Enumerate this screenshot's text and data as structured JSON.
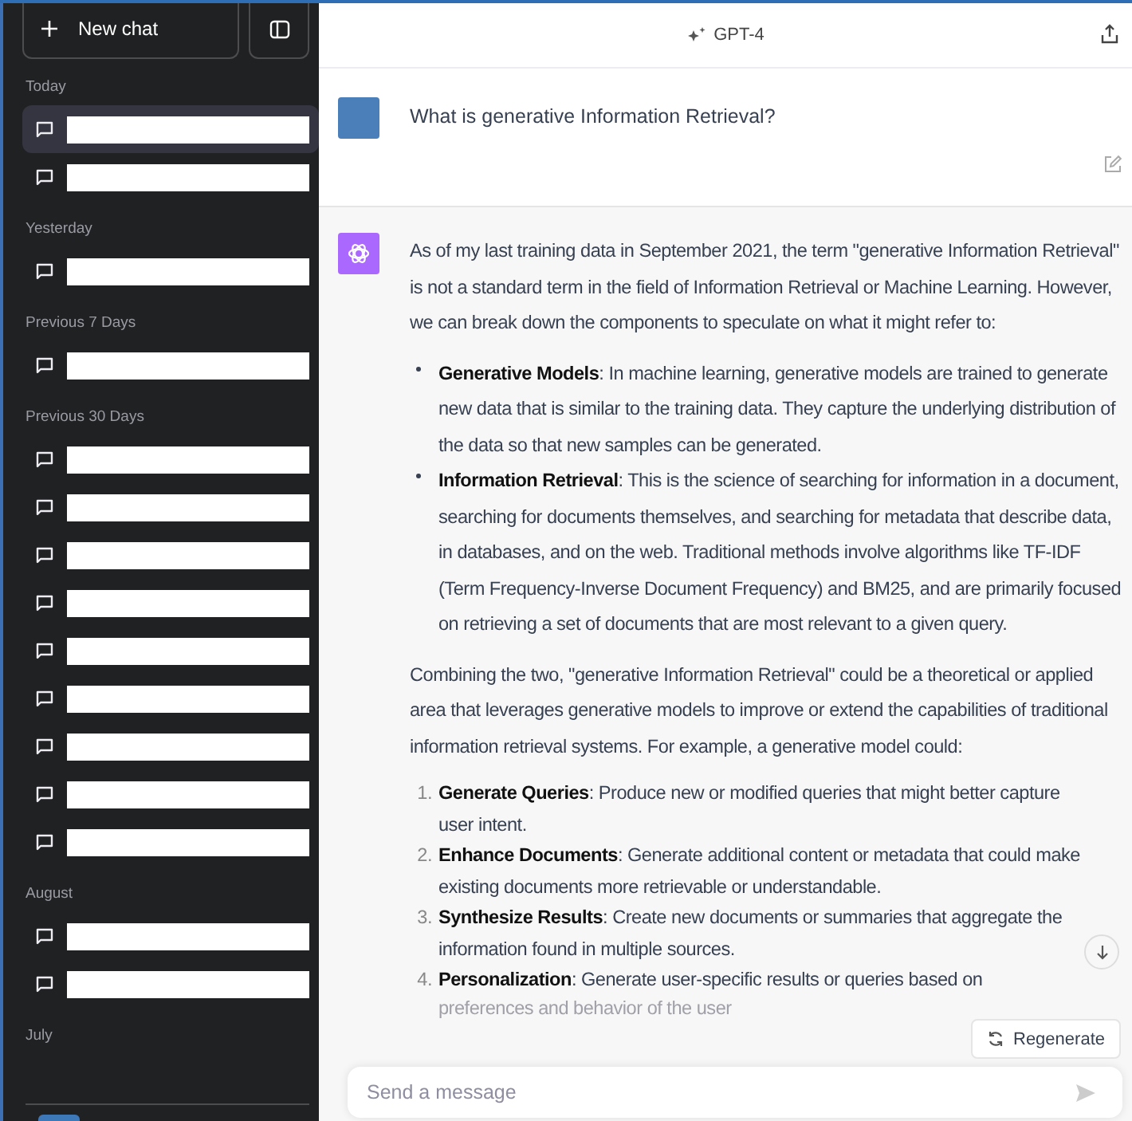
{
  "sidebar": {
    "new_chat_label": "New chat",
    "sections": [
      {
        "label": "Today",
        "chats": [
          {
            "selected": true
          },
          {
            "selected": false
          }
        ]
      },
      {
        "label": "Yesterday",
        "chats": [
          {
            "selected": false
          }
        ]
      },
      {
        "label": "Previous 7 Days",
        "chats": [
          {
            "selected": false
          }
        ]
      },
      {
        "label": "Previous 30 Days",
        "chats": [
          {
            "selected": false
          },
          {
            "selected": false
          },
          {
            "selected": false
          },
          {
            "selected": false
          },
          {
            "selected": false
          },
          {
            "selected": false
          },
          {
            "selected": false
          },
          {
            "selected": false
          },
          {
            "selected": false
          }
        ]
      },
      {
        "label": "August",
        "chats": [
          {
            "selected": false
          },
          {
            "selected": false
          }
        ]
      },
      {
        "label": "July"
      }
    ]
  },
  "header": {
    "model": "GPT-4"
  },
  "user_message": {
    "text": "What is generative Information Retrieval?"
  },
  "assistant_message": {
    "intro": "As of my last training data in September 2021, the term \"generative Information Retrieval\" is not a standard term in the field of Information Retrieval or Machine Learning. However, we can break down the components to speculate on what it might refer to:",
    "bullets": [
      {
        "text": "**Generative Models**: In machine learning, generative models are trained to generate new data that is similar to the training data. They capture the underlying distribution of the data so that new samples can be generated."
      },
      {
        "text": "**Information Retrieval**: This is the science of searching for information in a document, searching for documents themselves, and searching for metadata that describe data, in databases, and on the web. Traditional methods involve algorithms like TF-IDF (Term Frequency-Inverse Document Frequency) and BM25, and are primarily focused on retrieving a set of documents that are most relevant to a given query."
      }
    ],
    "middle": "Combining the two, \"generative Information Retrieval\" could be a theoretical or applied area that leverages generative models to improve or extend the capabilities of traditional information retrieval systems. For example, a generative model could:",
    "steps": [
      {
        "number": "1.",
        "lines": [
          "**Generate Queries**: Produce new or modified queries that might better capture user intent."
        ]
      },
      {
        "number": "2.",
        "lines": [
          "**Enhance Documents**: Generate additional content or metadata that could make existing documents more retrievable or understandable."
        ]
      },
      {
        "number": "3.",
        "lines": [
          "**Synthesize Results**: Create new documents or summaries that aggregate the information found in multiple sources."
        ]
      },
      {
        "number": "4.",
        "lines": [
          "**Personalization**: Generate user-specific results or queries based on",
          "preferences and behavior of the user"
        ]
      }
    ]
  },
  "regenerate_button": {
    "label": "Regenerate"
  },
  "composer": {
    "placeholder": "Send a message"
  }
}
